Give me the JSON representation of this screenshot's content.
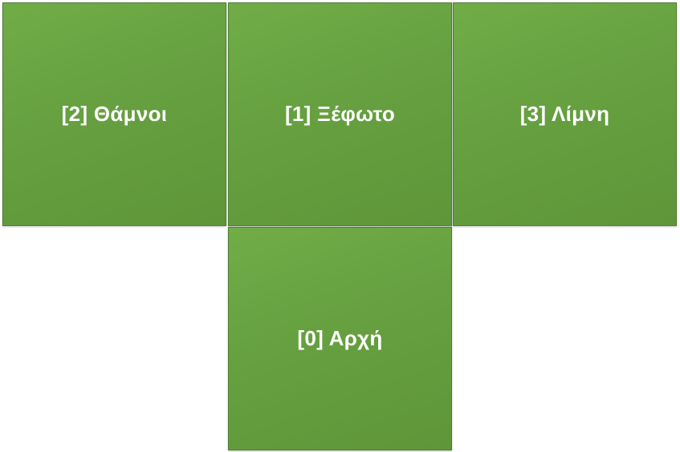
{
  "tiles": {
    "left": {
      "label": "[2] Θάμνοι"
    },
    "center": {
      "label": "[1] Ξέφωτο"
    },
    "right": {
      "label": "[3] Λίμνη"
    },
    "bottom": {
      "label": "[0] Αρχή"
    }
  },
  "colors": {
    "tile_fill": "#66a040",
    "tile_border": "#4e7f32",
    "label_text": "#ffffff",
    "background": "#ffffff"
  }
}
